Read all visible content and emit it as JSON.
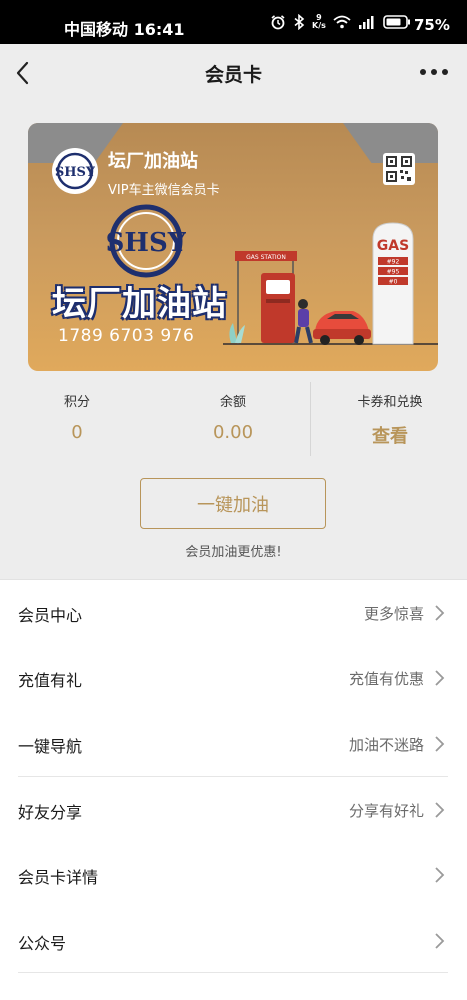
{
  "status_bar": {
    "carrier_time": "中国移动 16:41",
    "net_speed_value": "9",
    "net_speed_unit": "K/s",
    "battery": "75%"
  },
  "nav": {
    "title": "会员卡",
    "back_icon": "chevron-left-icon",
    "more_icon": "more-dots-icon"
  },
  "card": {
    "station_name": "坛厂加油站",
    "subtitle": "VIP车主微信会员卡",
    "logo_text": "SHSY",
    "big_name": "坛厂加油站",
    "card_number": "1789 6703 976",
    "gas_station_sign": "GAS STATION",
    "gas_sign": "GAS",
    "pump_prices": [
      "#92",
      "#95",
      "#0"
    ]
  },
  "stats": {
    "points_label": "积分",
    "points_value": "0",
    "balance_label": "余额",
    "balance_value": "0.00",
    "coupon_label": "卡券和兑换",
    "coupon_value": "查看"
  },
  "refuel": {
    "button_label": "一键加油",
    "tip": "会员加油更优惠!"
  },
  "menu": [
    {
      "label": "会员中心",
      "hint": "更多惊喜"
    },
    {
      "label": "充值有礼",
      "hint": "充值有优惠"
    },
    {
      "label": "一键导航",
      "hint": "加油不迷路"
    },
    {
      "label": "好友分享",
      "hint": "分享有好礼"
    },
    {
      "label": "会员卡详情",
      "hint": ""
    },
    {
      "label": "公众号",
      "hint": ""
    }
  ],
  "colors": {
    "accent_gold": "#b8955a",
    "card_gradient_top": "#b78a53",
    "card_gradient_bottom": "#e0a95c",
    "logo_navy": "#1e2f6e"
  }
}
